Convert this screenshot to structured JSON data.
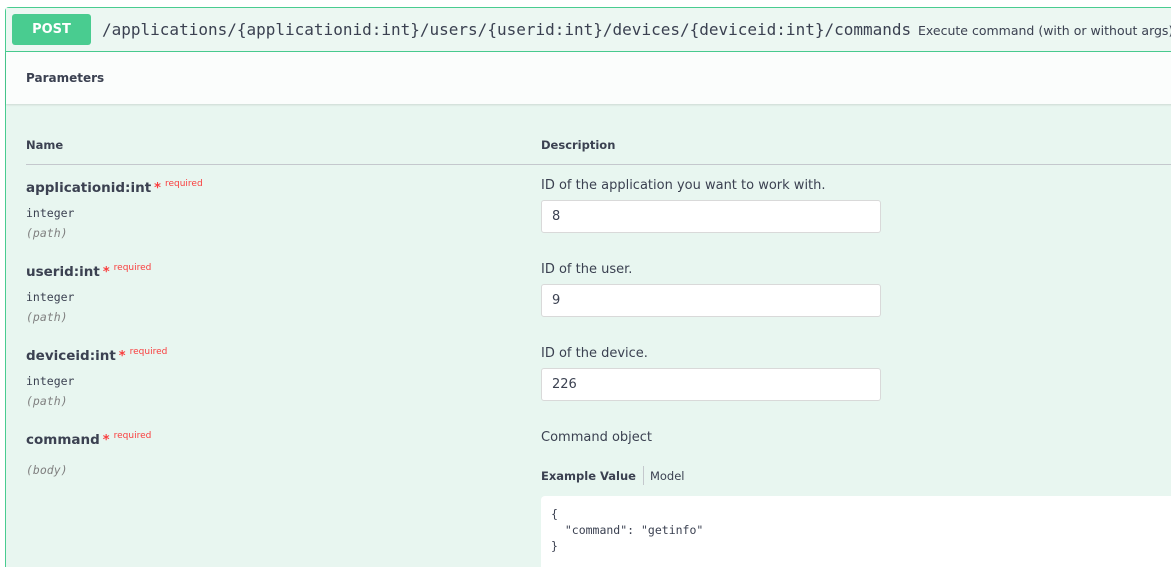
{
  "operation": {
    "method": "POST",
    "path": "/applications/{applicationid:int}/users/{userid:int}/devices/{deviceid:int}/commands",
    "summary": "Execute command (with or without args)",
    "accent_color": "#49cc90"
  },
  "parameters": {
    "title": "Parameters",
    "columns": {
      "name": "Name",
      "description": "Description"
    },
    "required_mark": "*",
    "required_label": "required",
    "items": [
      {
        "name": "applicationid:int",
        "type": "integer",
        "in": "(path)",
        "description": "ID of the application you want to work with.",
        "value": "8"
      },
      {
        "name": "userid:int",
        "type": "integer",
        "in": "(path)",
        "description": "ID of the user.",
        "value": "9"
      },
      {
        "name": "deviceid:int",
        "type": "integer",
        "in": "(path)",
        "description": "ID of the device.",
        "value": "226"
      },
      {
        "name": "command",
        "in": "(body)",
        "description": "Command object"
      }
    ]
  },
  "body_example": {
    "tab_example": "Example Value",
    "tab_model": "Model",
    "code": "{\n  \"command\": \"getinfo\"\n}"
  }
}
